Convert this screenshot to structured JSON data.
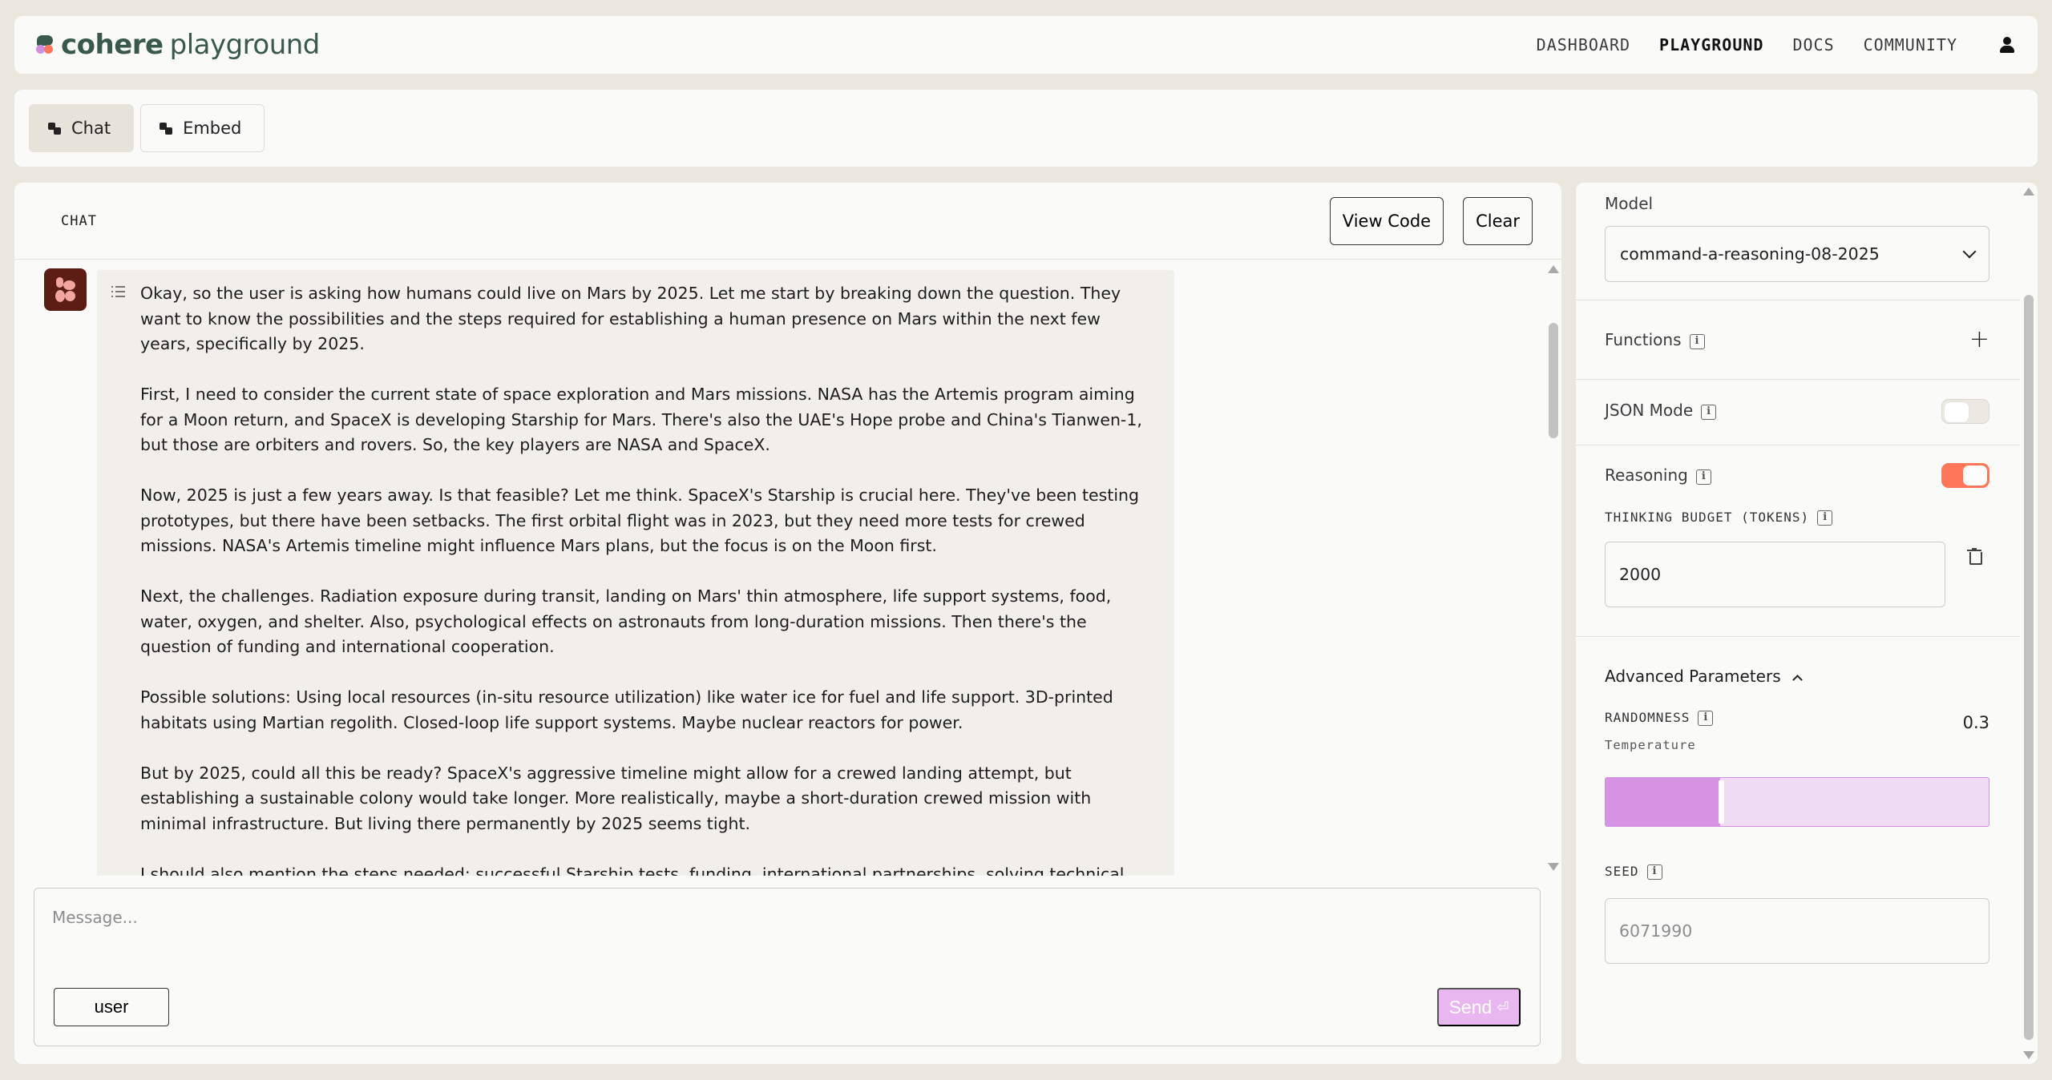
{
  "brand": {
    "logo_bold": "cohere",
    "logo_light": "playground"
  },
  "nav": {
    "links": [
      "DASHBOARD",
      "PLAYGROUND",
      "DOCS",
      "COMMUNITY"
    ],
    "active": "PLAYGROUND"
  },
  "tabs": [
    {
      "label": "Chat",
      "active": true
    },
    {
      "label": "Embed",
      "active": false
    }
  ],
  "chat": {
    "title": "CHAT",
    "view_code_label": "View Code",
    "clear_label": "Clear",
    "reasoning_paragraphs": [
      "Okay, so the user is asking how humans could live on Mars by 2025. Let me start by breaking down the question. They want to know the possibilities and the steps required for establishing a human presence on Mars within the next few years, specifically by 2025.",
      "First, I need to consider the current state of space exploration and Mars missions. NASA has the Artemis program aiming for a Moon return, and SpaceX is developing Starship for Mars. There's also the UAE's Hope probe and China's Tianwen-1, but those are orbiters and rovers. So, the key players are NASA and SpaceX.",
      "Now, 2025 is just a few years away. Is that feasible? Let me think. SpaceX's Starship is crucial here. They've been testing prototypes, but there have been setbacks. The first orbital flight was in 2023, but they need more tests for crewed missions. NASA's Artemis timeline might influence Mars plans, but the focus is on the Moon first.",
      "Next, the challenges. Radiation exposure during transit, landing on Mars' thin atmosphere, life support systems, food, water, oxygen, and shelter. Also, psychological effects on astronauts from long-duration missions. Then there's the question of funding and international cooperation.",
      "Possible solutions: Using local resources (in-situ resource utilization) like water ice for fuel and life support. 3D-printed habitats using Martian regolith. Closed-loop life support systems. Maybe nuclear reactors for power.",
      "But by 2025, could all this be ready? SpaceX's aggressive timeline might allow for a crewed landing attempt, but establishing a sustainable colony would take longer. More realistically, maybe a short-duration crewed mission with minimal infrastructure. But living there permanently by 2025 seems tight.",
      "I should also mention the steps needed: successful Starship tests, funding, international partnerships, solving technical"
    ],
    "composer": {
      "placeholder": "Message...",
      "role_label": "user",
      "send_label": "Send",
      "send_icon": "⏎"
    }
  },
  "settings": {
    "model_label": "Model",
    "model_value": "command-a-reasoning-08-2025",
    "functions_label": "Functions",
    "json_mode_label": "JSON Mode",
    "json_mode_on": false,
    "reasoning_label": "Reasoning",
    "reasoning_on": true,
    "thinking_budget_label": "THINKING BUDGET (TOKENS)",
    "thinking_budget_value": "2000",
    "advanced_label": "Advanced Parameters",
    "randomness_label": "RANDOMNESS",
    "temperature_label": "Temperature",
    "temperature_value": "0.3",
    "temperature_fraction": 0.3,
    "seed_label": "SEED",
    "seed_placeholder": "6071990"
  },
  "colors": {
    "accent_orange": "#ff7759",
    "accent_purple": "#d693e4",
    "send_disabled": "#e8b7ef",
    "brand_green": "#39594d"
  }
}
